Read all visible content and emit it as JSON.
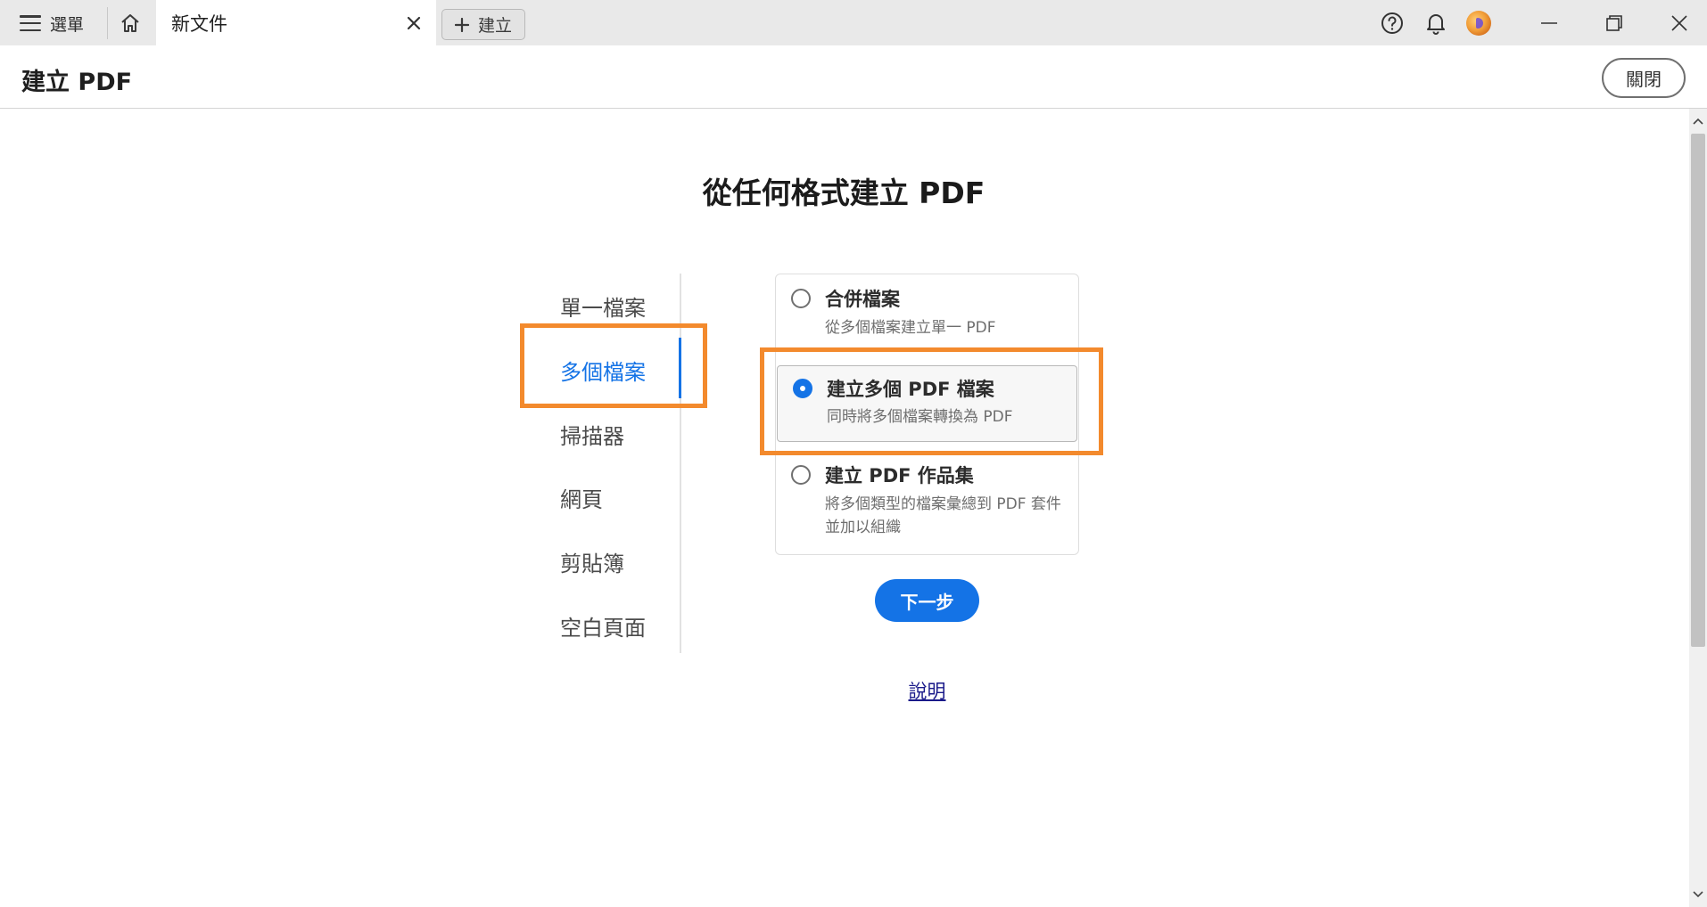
{
  "titlebar": {
    "menu_label": "選單",
    "tab_title": "新文件",
    "new_label": "建立",
    "icons": [
      "hamburger-icon",
      "home-icon",
      "close-icon",
      "plus-icon",
      "help-icon",
      "bell-icon",
      "minimize-icon",
      "restore-icon",
      "window-close-icon"
    ]
  },
  "tool": {
    "title": "建立 PDF",
    "close_label": "關閉"
  },
  "main": {
    "heading": "從任何格式建立 PDF",
    "nav_items": [
      {
        "label": "單一檔案",
        "active": false
      },
      {
        "label": "多個檔案",
        "active": true
      },
      {
        "label": "掃描器",
        "active": false
      },
      {
        "label": "網頁",
        "active": false
      },
      {
        "label": "剪貼簿",
        "active": false
      },
      {
        "label": "空白頁面",
        "active": false
      }
    ],
    "options": [
      {
        "title": "合併檔案",
        "desc": "從多個檔案建立單一 PDF",
        "checked": false
      },
      {
        "title": "建立多個 PDF 檔案",
        "desc": "同時將多個檔案轉換為 PDF",
        "checked": true
      },
      {
        "title": "建立 PDF 作品集",
        "desc": "將多個類型的檔案彙總到 PDF 套件並加以組織",
        "checked": false
      }
    ],
    "next_label": "下一步",
    "help_label": "說明"
  },
  "colors": {
    "accent": "#1473e6",
    "highlight": "#f38a2d",
    "titlebar_bg": "#e9e9e9"
  }
}
